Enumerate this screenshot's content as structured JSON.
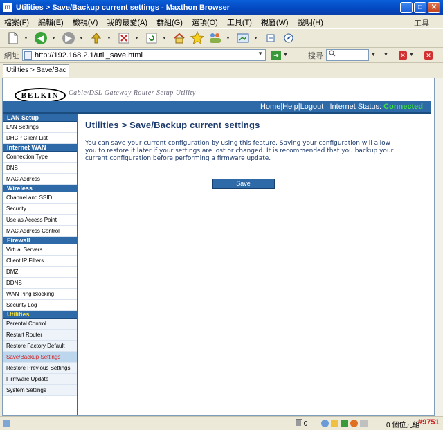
{
  "window": {
    "title": "Utilities > Save/Backup current settings - Maxthon Browser",
    "app_icon": "m",
    "min": "_",
    "max": "□",
    "close": "✕"
  },
  "menu": {
    "items": [
      "檔案(F)",
      "編輯(E)",
      "檢視(V)",
      "我的最愛(A)",
      "群組(G)",
      "選項(O)",
      "工具(T)",
      "視窗(W)",
      "說明(H)"
    ],
    "right_label": "工具"
  },
  "address": {
    "label": "網址",
    "url": "http://192.168.2.1/util_save.html",
    "search_label": "搜尋"
  },
  "tab": {
    "label": "Utilities > Save/Bac"
  },
  "header": {
    "logo": "BELKIN",
    "tagline": "Cable/DSL Gateway Router Setup Utility",
    "home": "Home",
    "help": "Help",
    "logout": "Logout",
    "sep": "|",
    "status_label": "Internet Status:",
    "status_value": "Connected"
  },
  "sidebar": {
    "sections": [
      {
        "title": "LAN Setup",
        "items": [
          "LAN Settings",
          "DHCP Client List"
        ]
      },
      {
        "title": "Internet WAN",
        "items": [
          "Connection Type",
          "DNS",
          "MAC Address"
        ]
      },
      {
        "title": "Wireless",
        "items": [
          "Channel and SSID",
          "Security",
          "Use as Access Point",
          "MAC Address Control"
        ]
      },
      {
        "title": "Firewall",
        "items": [
          "Virtual Servers",
          "Client IP Filters",
          "DMZ",
          "DDNS",
          "WAN Ping Blocking",
          "Security Log"
        ]
      },
      {
        "title": "Utilities",
        "items": [
          "Parental Control",
          "Restart Router",
          "Restore Factory Default",
          "Save/Backup Settings",
          "Restore Previous Settings",
          "Firmware Update",
          "System Settings"
        ]
      }
    ]
  },
  "content": {
    "title": "Utilities > Save/Backup current settings",
    "body": "You can save your current configuration by using this feature. Saving your configuration will allow you to restore it later if your settings are lost or changed. It is recommended that you backup your current configuration before performing a firmware update.",
    "save_label": "Save"
  },
  "status": {
    "count": "0",
    "info": "0 個位元組",
    "tag": "#9751"
  },
  "colors": {
    "nav_blue": "#2e6aa8",
    "connected_green": "#3fe23f",
    "active_item_red": "#d02020"
  }
}
